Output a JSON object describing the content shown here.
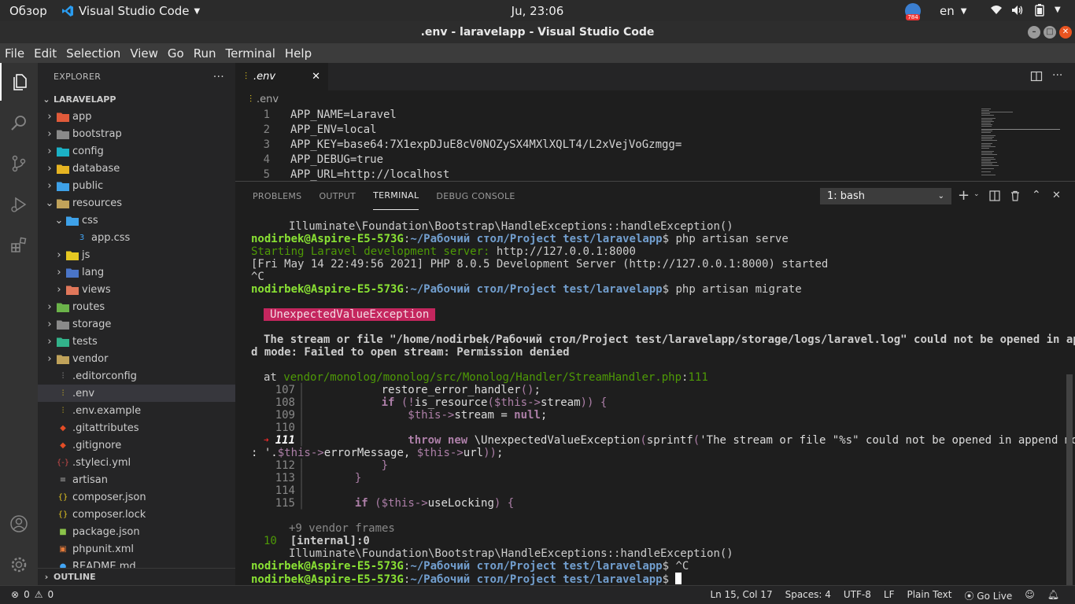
{
  "topbar": {
    "activities": "Обзор",
    "app_name": "Visual Studio Code",
    "clock": "Ju, 23:06",
    "notif_count": "784",
    "lang": "en"
  },
  "titlebar": {
    "title": ".env - laravelapp - Visual Studio Code"
  },
  "menu": [
    "File",
    "Edit",
    "Selection",
    "View",
    "Go",
    "Run",
    "Terminal",
    "Help"
  ],
  "sidebar": {
    "header": "EXPLORER",
    "project": "LARAVELAPP",
    "items": [
      {
        "label": "app",
        "type": "folder",
        "depth": 1,
        "color": "#e05a3a"
      },
      {
        "label": "bootstrap",
        "type": "folder",
        "depth": 1,
        "color": "#8a8a8a"
      },
      {
        "label": "config",
        "type": "folder",
        "depth": 1,
        "color": "#1bb1c6"
      },
      {
        "label": "database",
        "type": "folder",
        "depth": 1,
        "color": "#e6b422"
      },
      {
        "label": "public",
        "type": "folder",
        "depth": 1,
        "color": "#3ea1e8"
      },
      {
        "label": "resources",
        "type": "folder-open",
        "depth": 1,
        "color": "#c0a25a"
      },
      {
        "label": "css",
        "type": "folder-open",
        "depth": 2,
        "color": "#3ea1e8"
      },
      {
        "label": "app.css",
        "type": "file-css",
        "depth": 3,
        "color": "#42a5f5"
      },
      {
        "label": "js",
        "type": "folder",
        "depth": 2,
        "color": "#e6c822"
      },
      {
        "label": "lang",
        "type": "folder",
        "depth": 2,
        "color": "#4a75c8"
      },
      {
        "label": "views",
        "type": "folder",
        "depth": 2,
        "color": "#e0775a"
      },
      {
        "label": "routes",
        "type": "folder",
        "depth": 1,
        "color": "#6bb34a"
      },
      {
        "label": "storage",
        "type": "folder",
        "depth": 1,
        "color": "#8a8a8a"
      },
      {
        "label": "tests",
        "type": "folder",
        "depth": 1,
        "color": "#32b28a"
      },
      {
        "label": "vendor",
        "type": "folder",
        "depth": 1,
        "color": "#c0a25a"
      },
      {
        "label": ".editorconfig",
        "type": "file-settings",
        "depth": 1,
        "color": "#aaaaaa"
      },
      {
        "label": ".env",
        "type": "file-settings",
        "depth": 1,
        "color": "#e6c822",
        "selected": true
      },
      {
        "label": ".env.example",
        "type": "file-settings",
        "depth": 1,
        "color": "#e6c822"
      },
      {
        "label": ".gitattributes",
        "type": "file-git",
        "depth": 1,
        "color": "#e44d26"
      },
      {
        "label": ".gitignore",
        "type": "file-git",
        "depth": 1,
        "color": "#e44d26"
      },
      {
        "label": ".styleci.yml",
        "type": "file-yml",
        "depth": 1,
        "color": "#cb4b4b"
      },
      {
        "label": "artisan",
        "type": "file-plain",
        "depth": 1,
        "color": "#aaaaaa"
      },
      {
        "label": "composer.json",
        "type": "file-json",
        "depth": 1,
        "color": "#e6c822"
      },
      {
        "label": "composer.lock",
        "type": "file-json",
        "depth": 1,
        "color": "#e6c822"
      },
      {
        "label": "package.json",
        "type": "file-npm",
        "depth": 1,
        "color": "#8bc34a"
      },
      {
        "label": "phpunit.xml",
        "type": "file-xml",
        "depth": 1,
        "color": "#e47a3a"
      },
      {
        "label": "README.md",
        "type": "file-info",
        "depth": 1,
        "color": "#42a5f5"
      }
    ],
    "outline": "OUTLINE"
  },
  "editor": {
    "tab": ".env",
    "breadcrumb": ".env",
    "lines": [
      {
        "n": "1",
        "t": "APP_NAME=Laravel"
      },
      {
        "n": "2",
        "t": "APP_ENV=local"
      },
      {
        "n": "3",
        "t": "APP_KEY=base64:7X1expDJuE8cV0NOZySX4MXlXQLT4/L2xVejVoGzmgg="
      },
      {
        "n": "4",
        "t": "APP_DEBUG=true"
      },
      {
        "n": "5",
        "t": "APP_URL=http://localhost"
      }
    ]
  },
  "panel": {
    "tabs": [
      "PROBLEMS",
      "OUTPUT",
      "TERMINAL",
      "DEBUG CONSOLE"
    ],
    "active_tab": "TERMINAL",
    "terminal_select": "1: bash"
  },
  "terminal": {
    "handle_exc": "Illuminate\\Foundation\\Bootstrap\\HandleExceptions::handleException()",
    "prompt_user": "nodirbek@Aspire-E5-573G",
    "prompt_path": "~/Рабочий стол/Project test/laravelapp",
    "cmd_serve": " php artisan serve",
    "serve_start": "Starting Laravel development server:",
    "serve_url": " http://127.0.0.1:8000",
    "serve_started": "[Fri May 14 22:49:56 2021] PHP 8.0.5 Development Server (http://127.0.0.1:8000) started",
    "ctrl_c": "^C",
    "cmd_migrate": " php artisan migrate",
    "exception": "UnexpectedValueException",
    "msg1": "The stream or file \"/home/nodirbek/Рабочий стол/Project test/laravelapp/storage/logs/laravel.log\" could not be opened in appen",
    "msg2": "d mode: Failed to open stream: Permission denied",
    "at": "at ",
    "at_path": "vendor/monolog/monolog/src/Monolog/Handler/StreamHandler.php",
    "at_line": "111",
    "src": [
      {
        "n": "107",
        "t": "            restore_error_handler();"
      },
      {
        "n": "108",
        "t": "            if (!is_resource($this->stream)) {"
      },
      {
        "n": "109",
        "t": "                $this->stream = null;"
      },
      {
        "n": "110",
        "t": ""
      },
      {
        "n": "111",
        "t": "                throw new \\UnexpectedValueException(sprintf('The stream or file \"%s\" could not be opened in append mode"
      },
      {
        "n": "",
        "t": ": '.$this->errorMessage, $this->url));"
      },
      {
        "n": "112",
        "t": "            }"
      },
      {
        "n": "113",
        "t": "        }"
      },
      {
        "n": "114",
        "t": ""
      },
      {
        "n": "115",
        "t": "        if ($this->useLocking) {"
      }
    ],
    "vendor_frames": "+9 vendor frames",
    "frame_num": "10",
    "internal": "[internal]:0",
    "cursor_cmd": " ^C"
  },
  "status": {
    "errors": "0",
    "warnings": "0",
    "position": "Ln 15, Col 17",
    "spaces": "Spaces: 4",
    "encoding": "UTF-8",
    "eol": "LF",
    "language": "Plain Text",
    "golive": "Go Live"
  }
}
